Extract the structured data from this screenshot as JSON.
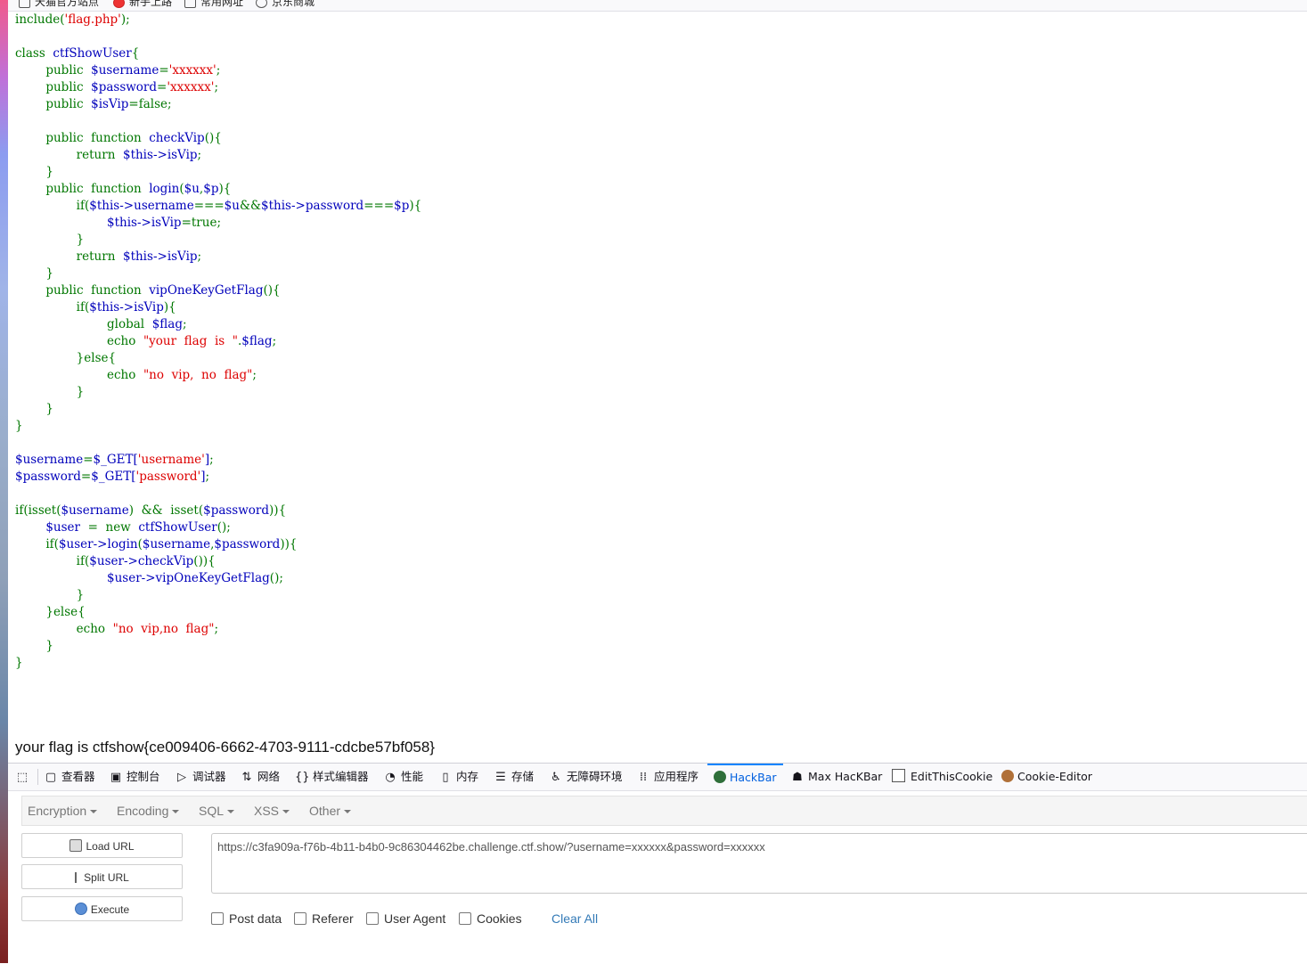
{
  "bookmarks": [
    {
      "label": "天猫官方站点",
      "icon": "folder-icon"
    },
    {
      "label": "新手上路",
      "icon": "firefox-icon"
    },
    {
      "label": "常用网址",
      "icon": "folder-icon"
    },
    {
      "label": "京东商城",
      "icon": "globe-icon"
    }
  ],
  "source_code": {
    "lines": [
      "include('flag.php');",
      "",
      "class  ctfShowUser{",
      "        public  $username='xxxxxx';",
      "        public  $password='xxxxxx';",
      "        public  $isVip=false;",
      "",
      "        public  function  checkVip(){",
      "                return  $this->isVip;",
      "        }",
      "        public  function  login($u,$p){",
      "                if($this->username===$u&&$this->password===$p){",
      "                        $this->isVip=true;",
      "                }",
      "                return  $this->isVip;",
      "        }",
      "        public  function  vipOneKeyGetFlag(){",
      "                if($this->isVip){",
      "                        global  $flag;",
      "                        echo  \"your  flag  is  \".$flag;",
      "                }else{",
      "                        echo  \"no  vip,  no  flag\";",
      "                }",
      "        }",
      "}",
      "",
      "$username=$_GET['username'];",
      "$password=$_GET['password'];",
      "",
      "if(isset($username)  &&  isset($password)){",
      "        $user  =  new  ctfShowUser();",
      "        if($user->login($username,$password)){",
      "                if($user->checkVip()){",
      "                        $user->vipOneKeyGetFlag();",
      "                }",
      "        }else{",
      "                echo  \"no  vip,no  flag\";",
      "        }",
      "}"
    ]
  },
  "output": {
    "flag_text": "your flag is ctfshow{ce009406-6662-4703-9111-cdcbe57bf058}"
  },
  "devtools": {
    "tabs": [
      {
        "label": "查看器",
        "icon": "inspector-icon"
      },
      {
        "label": "控制台",
        "icon": "console-icon"
      },
      {
        "label": "调试器",
        "icon": "debugger-icon"
      },
      {
        "label": "网络",
        "icon": "network-icon"
      },
      {
        "label": "样式编辑器",
        "icon": "style-editor-icon"
      },
      {
        "label": "性能",
        "icon": "performance-icon"
      },
      {
        "label": "内存",
        "icon": "memory-icon"
      },
      {
        "label": "存储",
        "icon": "storage-icon"
      },
      {
        "label": "无障碍环境",
        "icon": "accessibility-icon"
      },
      {
        "label": "应用程序",
        "icon": "application-icon"
      },
      {
        "label": "HackBar",
        "icon": "hackbar-icon",
        "active": true
      },
      {
        "label": "Max HacKBar",
        "icon": "max-hackbar-icon"
      },
      {
        "label": "EditThisCookie",
        "icon": "editthiscookie-icon"
      },
      {
        "label": "Cookie-Editor",
        "icon": "cookie-icon"
      }
    ],
    "active_color": "#0060df"
  },
  "hackbar": {
    "menu": [
      "Encryption",
      "Encoding",
      "SQL",
      "XSS",
      "Other"
    ],
    "buttons": {
      "load": "Load URL",
      "split": "Split URL",
      "execute": "Execute"
    },
    "url": "https://c3fa909a-f76b-4b11-b4b0-9c86304462be.challenge.ctf.show/?username=xxxxxx&password=xxxxxx",
    "options": [
      "Post data",
      "Referer",
      "User Agent",
      "Cookies"
    ],
    "clear_all": "Clear All"
  }
}
